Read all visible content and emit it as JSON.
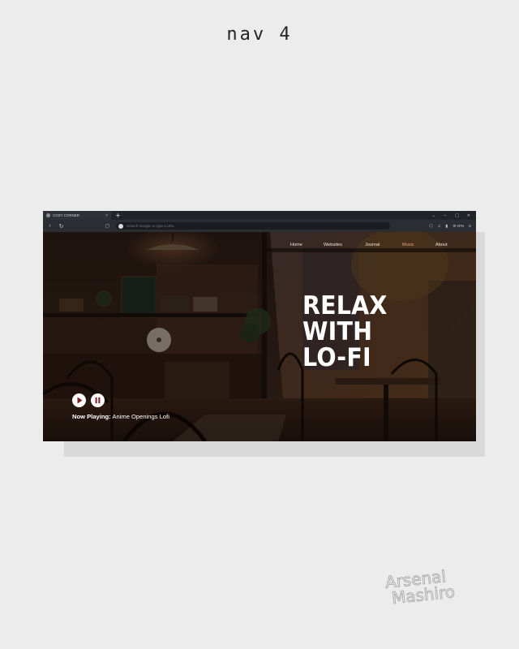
{
  "page": {
    "title": "nav 4"
  },
  "browser": {
    "tab_title": "COZY CORNER",
    "tab_close": "×",
    "new_tab": "+",
    "window_controls": {
      "chevron": "⌄",
      "minimize": "−",
      "maximize": "□",
      "close": "✕"
    },
    "omnibox_placeholder": "Search Google or type a URL",
    "vpn_label": "VPN"
  },
  "site": {
    "nav": [
      {
        "label": "Home"
      },
      {
        "label": "Websites"
      },
      {
        "label": "Journal"
      },
      {
        "label": "Music",
        "active": true
      },
      {
        "label": "About"
      }
    ],
    "hero": {
      "line1": "RELAX",
      "line2": "WITH",
      "line3": "LO-FI"
    },
    "player": {
      "now_playing_label": "Now Playing:",
      "track": "Anime Openings Lofi",
      "controls": [
        "play-icon",
        "pause-icon"
      ]
    },
    "colors": {
      "accent": "#7a1f26",
      "active_nav": "#e9a27a",
      "text": "#ffffff"
    }
  },
  "watermark": {
    "line1": "Arsenal",
    "line2": "Mashiro"
  }
}
